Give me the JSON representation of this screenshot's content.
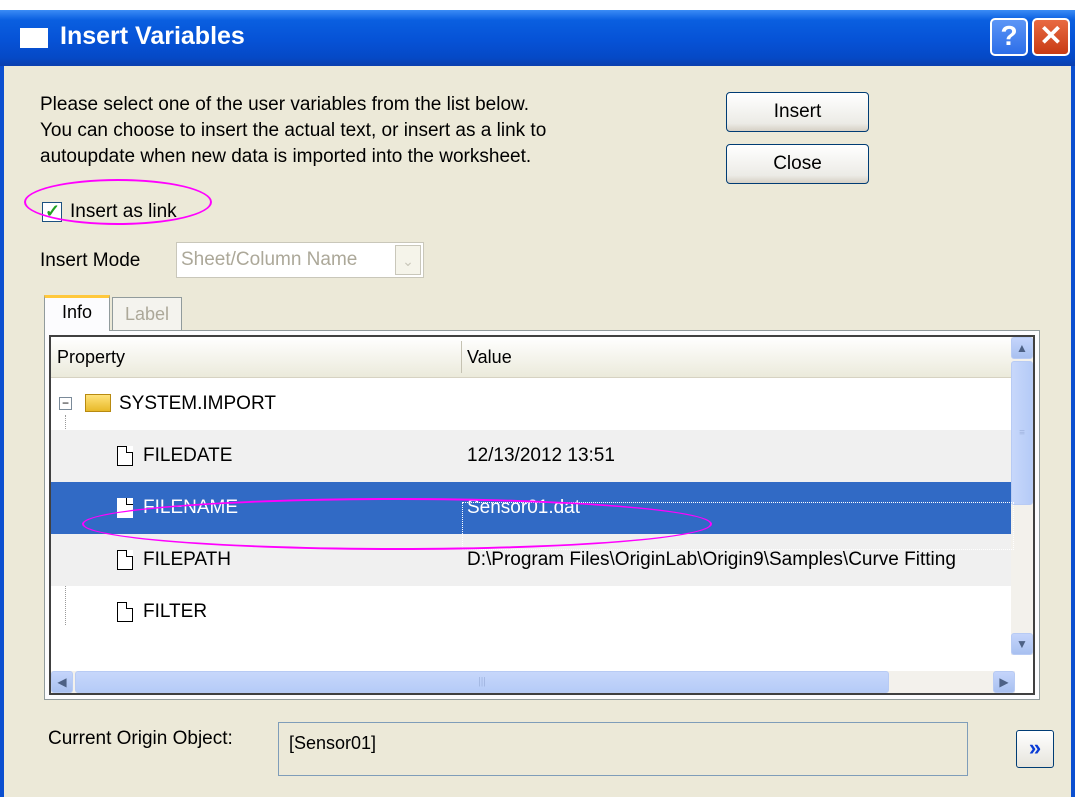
{
  "window": {
    "title": "Insert Variables",
    "help_label": "?",
    "close_label": "✕"
  },
  "instructions": [
    "Please select one of the user variables from the list below.",
    "You can choose to insert the actual text, or insert as a link to",
    "autoupdate when new data is imported into the worksheet."
  ],
  "buttons": {
    "insert": "Insert",
    "close": "Close",
    "expand": "»"
  },
  "checkbox": {
    "label": "Insert as link",
    "checked": true,
    "mark": "✓"
  },
  "insert_mode": {
    "label": "Insert Mode",
    "value": "Sheet/Column Name",
    "arrow": "⌄"
  },
  "tabs": [
    {
      "label": "Info",
      "active": true
    },
    {
      "label": "Label",
      "active": false
    }
  ],
  "grid": {
    "columns": [
      "Property",
      "Value"
    ],
    "tree_root": {
      "expander": "−",
      "label": "SYSTEM.IMPORT"
    },
    "rows": [
      {
        "property": "FILEDATE",
        "value": "12/13/2012 13:51"
      },
      {
        "property": "FILENAME",
        "value": "Sensor01.dat",
        "selected": true
      },
      {
        "property": "FILEPATH",
        "value": "D:\\Program Files\\OriginLab\\Origin9\\Samples\\Curve Fitting"
      },
      {
        "property": "FILTER",
        "value": ""
      }
    ],
    "scroll_up": "▲",
    "scroll_down": "▼",
    "scroll_left": "◀",
    "scroll_right": "▶",
    "grip": "≡",
    "grip_h": "|||"
  },
  "current_object": {
    "label": "Current Origin Object:",
    "value": "[Sensor01]"
  },
  "colors": {
    "titlebar": "#0652d6",
    "selection": "#316ac5",
    "highlight": "#ff00ff",
    "dialog_bg": "#ece9d8"
  }
}
